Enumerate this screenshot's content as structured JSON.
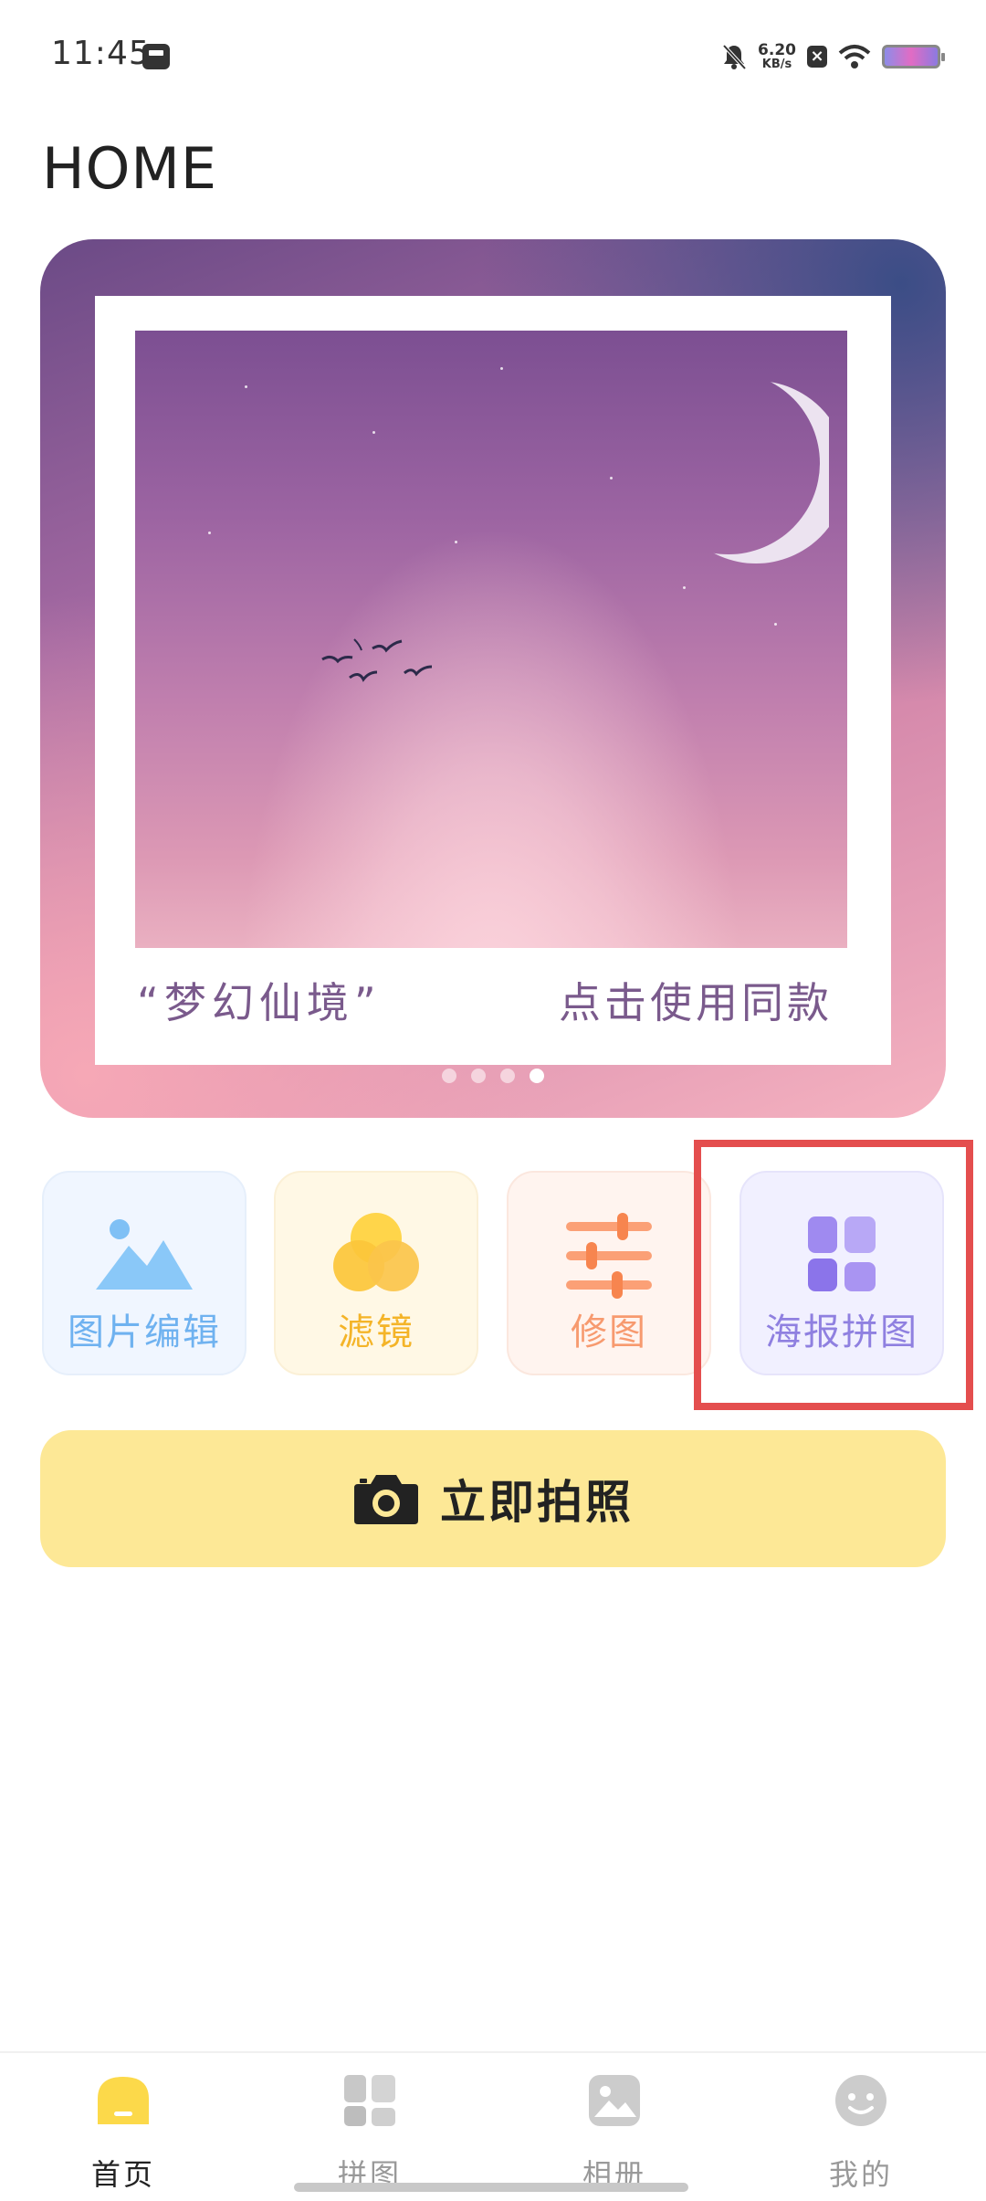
{
  "status_bar": {
    "time": "11:45",
    "net_speed_value": "6.20",
    "net_speed_unit": "KB/s"
  },
  "page": {
    "title": "HOME"
  },
  "banner": {
    "caption_left": "“梦幻仙境”",
    "caption_right": "点击使用同款",
    "carousel_pages": 4,
    "carousel_active_index": 3
  },
  "features": [
    {
      "label": "图片编辑",
      "icon": "mountain-image-icon",
      "color": "#6fb2f0"
    },
    {
      "label": "滤镜",
      "icon": "filter-circles-icon",
      "color": "#f4b428"
    },
    {
      "label": "修图",
      "icon": "sliders-icon",
      "color": "#f79a6f"
    },
    {
      "label": "海报拼图",
      "icon": "grid-layout-icon",
      "color": "#8f80e0"
    }
  ],
  "camera_button": {
    "label": "立即拍照",
    "icon": "camera-icon"
  },
  "bottom_nav": [
    {
      "label": "首页",
      "icon": "home-icon",
      "active": true
    },
    {
      "label": "拼图",
      "icon": "collage-icon",
      "active": false
    },
    {
      "label": "相册",
      "icon": "album-icon",
      "active": false
    },
    {
      "label": "我的",
      "icon": "profile-icon",
      "active": false
    }
  ],
  "highlight_color": "#e44e4e"
}
